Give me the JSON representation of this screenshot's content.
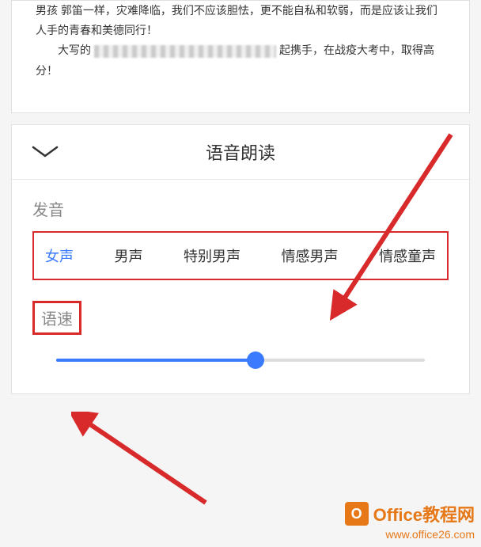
{
  "content": {
    "line1": "男孩 郭笛一样，灾难降临，我们不应该胆怯，更不能自私和软弱，而是应该让我们人手的青春和美德同行！",
    "line2_prefix": "大写的",
    "line2_suffix": "起携手，在战疫大考中，取得高分！"
  },
  "panel": {
    "title": "语音朗读",
    "voice_section_label": "发音",
    "voices": [
      {
        "label": "女声",
        "active": true
      },
      {
        "label": "男声",
        "active": false
      },
      {
        "label": "特别男声",
        "active": false
      },
      {
        "label": "情感男声",
        "active": false
      },
      {
        "label": "情感童声",
        "active": false
      }
    ],
    "speed_section_label": "语速",
    "speed_value": 54
  },
  "watermark": {
    "brand": "Office教程网",
    "url": "www.office26.com"
  },
  "colors": {
    "accent": "#3a7afe",
    "highlight": "#d82a2a",
    "brand": "#e67817"
  }
}
